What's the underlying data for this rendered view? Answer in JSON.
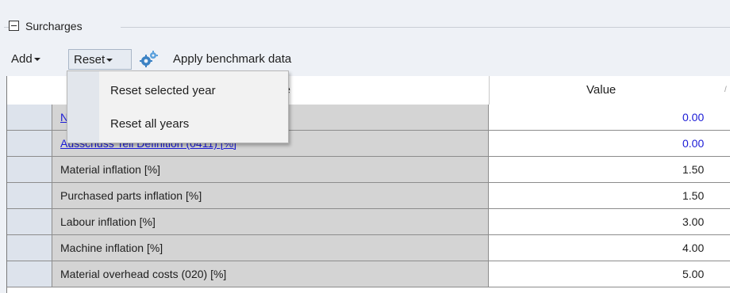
{
  "group": {
    "title": "Surcharges"
  },
  "toolbar": {
    "add_label": "Add",
    "reset_label": "Reset",
    "benchmark_label": "Apply benchmark data",
    "benchmark_icon": "gears-icon"
  },
  "menu": {
    "items": [
      {
        "label": "Reset selected year"
      },
      {
        "label": "Reset all years"
      }
    ]
  },
  "grid": {
    "columns": {
      "name": "Surcharge",
      "name_visible": "arge",
      "value": "Value"
    },
    "rows": [
      {
        "name": "N",
        "value": "0.00",
        "link": true
      },
      {
        "name": "Ausschuss Teil Definition (0411) [%]",
        "value": "0.00",
        "link": true
      },
      {
        "name": "Material inflation [%]",
        "value": "1.50"
      },
      {
        "name": "Purchased parts inflation [%]",
        "value": "1.50"
      },
      {
        "name": "Labour inflation [%]",
        "value": "3.00"
      },
      {
        "name": "Machine inflation [%]",
        "value": "4.00"
      },
      {
        "name": "Material overhead costs (020) [%]",
        "value": "5.00"
      }
    ]
  },
  "colors": {
    "link": "#1a1ad6",
    "name_cell_bg": "#d4d4d4",
    "panel_bg": "#eef1f6"
  }
}
